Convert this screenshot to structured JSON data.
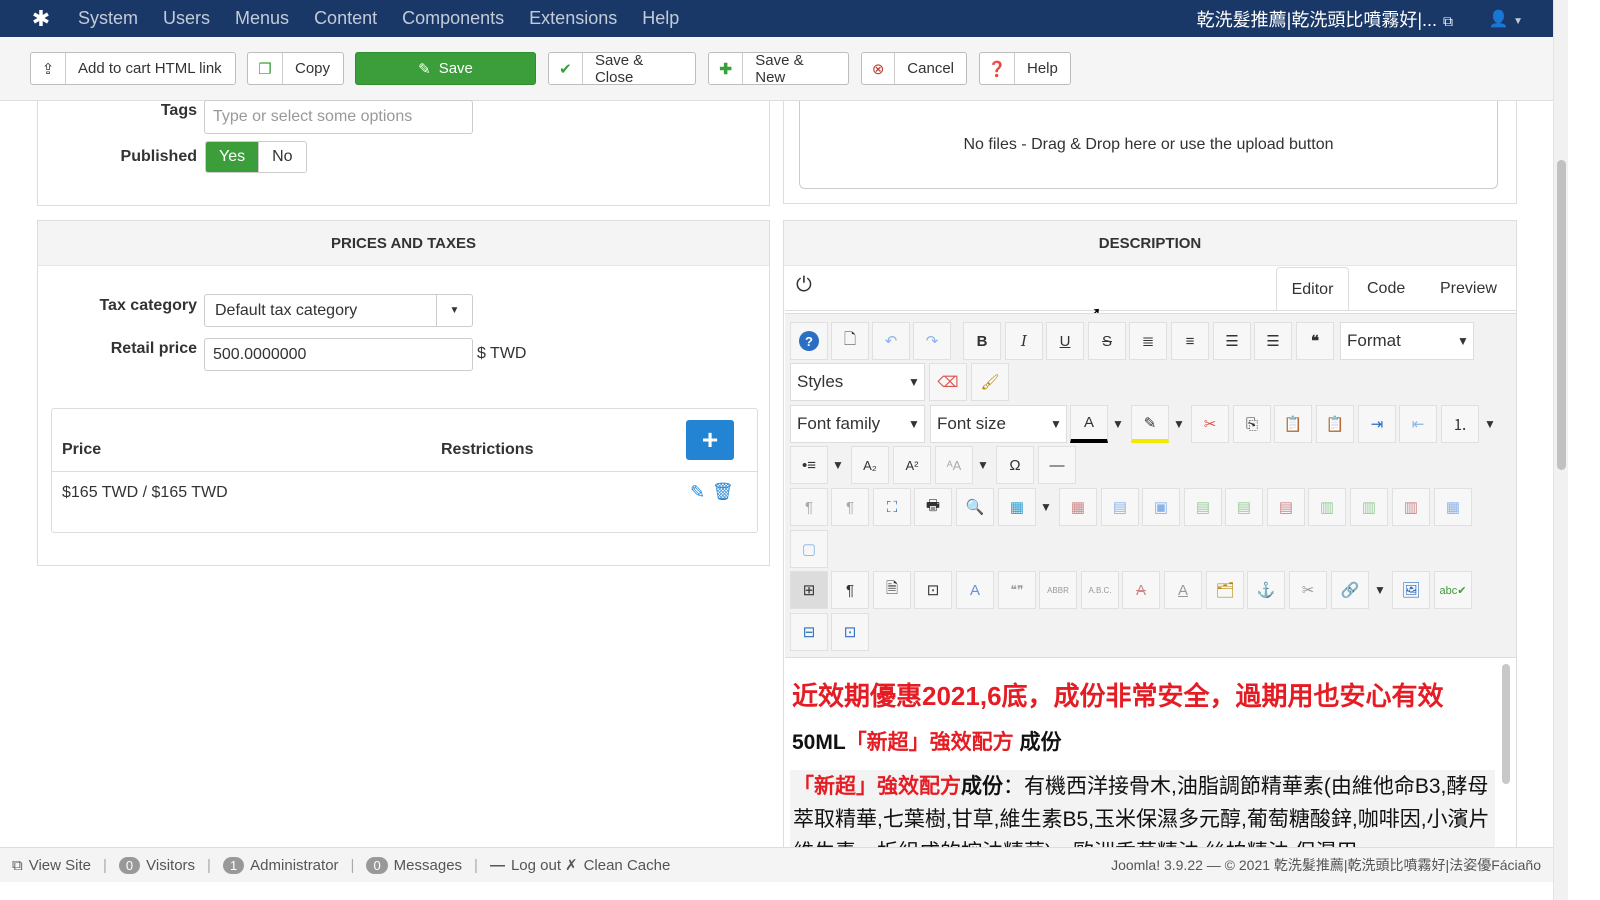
{
  "nav": {
    "menu": [
      "System",
      "Users",
      "Menus",
      "Content",
      "Components",
      "Extensions",
      "Help"
    ],
    "site_title": "乾洗髮推薦|乾洗頭比噴霧好|..."
  },
  "toolbar": {
    "add_cart": "Add to cart HTML link",
    "copy": "Copy",
    "save": "Save",
    "save_close": "Save & Close",
    "save_new": "Save & New",
    "cancel": "Cancel",
    "help": "Help"
  },
  "details": {
    "tags_label": "Tags",
    "tags_placeholder": "Type or select some options",
    "published_label": "Published",
    "yes": "Yes",
    "no": "No",
    "published_value": "Yes"
  },
  "files": {
    "dropzone_text": "No files - Drag & Drop here or use the upload button"
  },
  "prices": {
    "heading": "PRICES AND TAXES",
    "tax_label": "Tax category",
    "tax_value": "Default tax category",
    "retail_label": "Retail price",
    "retail_value": "500.0000000",
    "currency": "$ TWD",
    "col_price": "Price",
    "col_restrictions": "Restrictions",
    "rows": [
      {
        "price": "$165 TWD / $165 TWD",
        "restrictions": ""
      }
    ]
  },
  "description": {
    "heading": "DESCRIPTION",
    "tabs": [
      "Editor",
      "Code",
      "Preview"
    ],
    "active_tab": "Editor",
    "selects": {
      "format": "Format",
      "styles": "Styles",
      "font_family": "Font family",
      "font_size": "Font size"
    },
    "content": {
      "line1": "近效期優惠2021,6底，成份非常安全，過期用也安心有效",
      "line2_prefix": "50ML",
      "line2_red": "「新超」強效配方",
      "line2_suffix": " 成份",
      "para_red": "「新超」強效配方",
      "para_bold": "成份",
      "para_text": "：有機西洋接骨木,油脂調節精華素(由維他命B3,酵母萃取精華,七葉樹,甘草,維生素B5,玉米保濕多元醇,葡萄糖酸鋅,咖啡因,小濱片維生素，折組成的控油精華)，歐洲香草精油,絲柏精油,保濕甲"
    }
  },
  "status": {
    "view_site": "View Site",
    "visitors_count": "0",
    "visitors": "Visitors",
    "admin_count": "1",
    "admin": "Administrator",
    "messages_count": "0",
    "messages": "Messages",
    "logout": "Log out",
    "clean_cache": "Clean Cache",
    "version": "Joomla! 3.9.22 — © 2021 乾洗髮推薦|乾洗頭比噴霧好|法姿優Fáciaño"
  }
}
